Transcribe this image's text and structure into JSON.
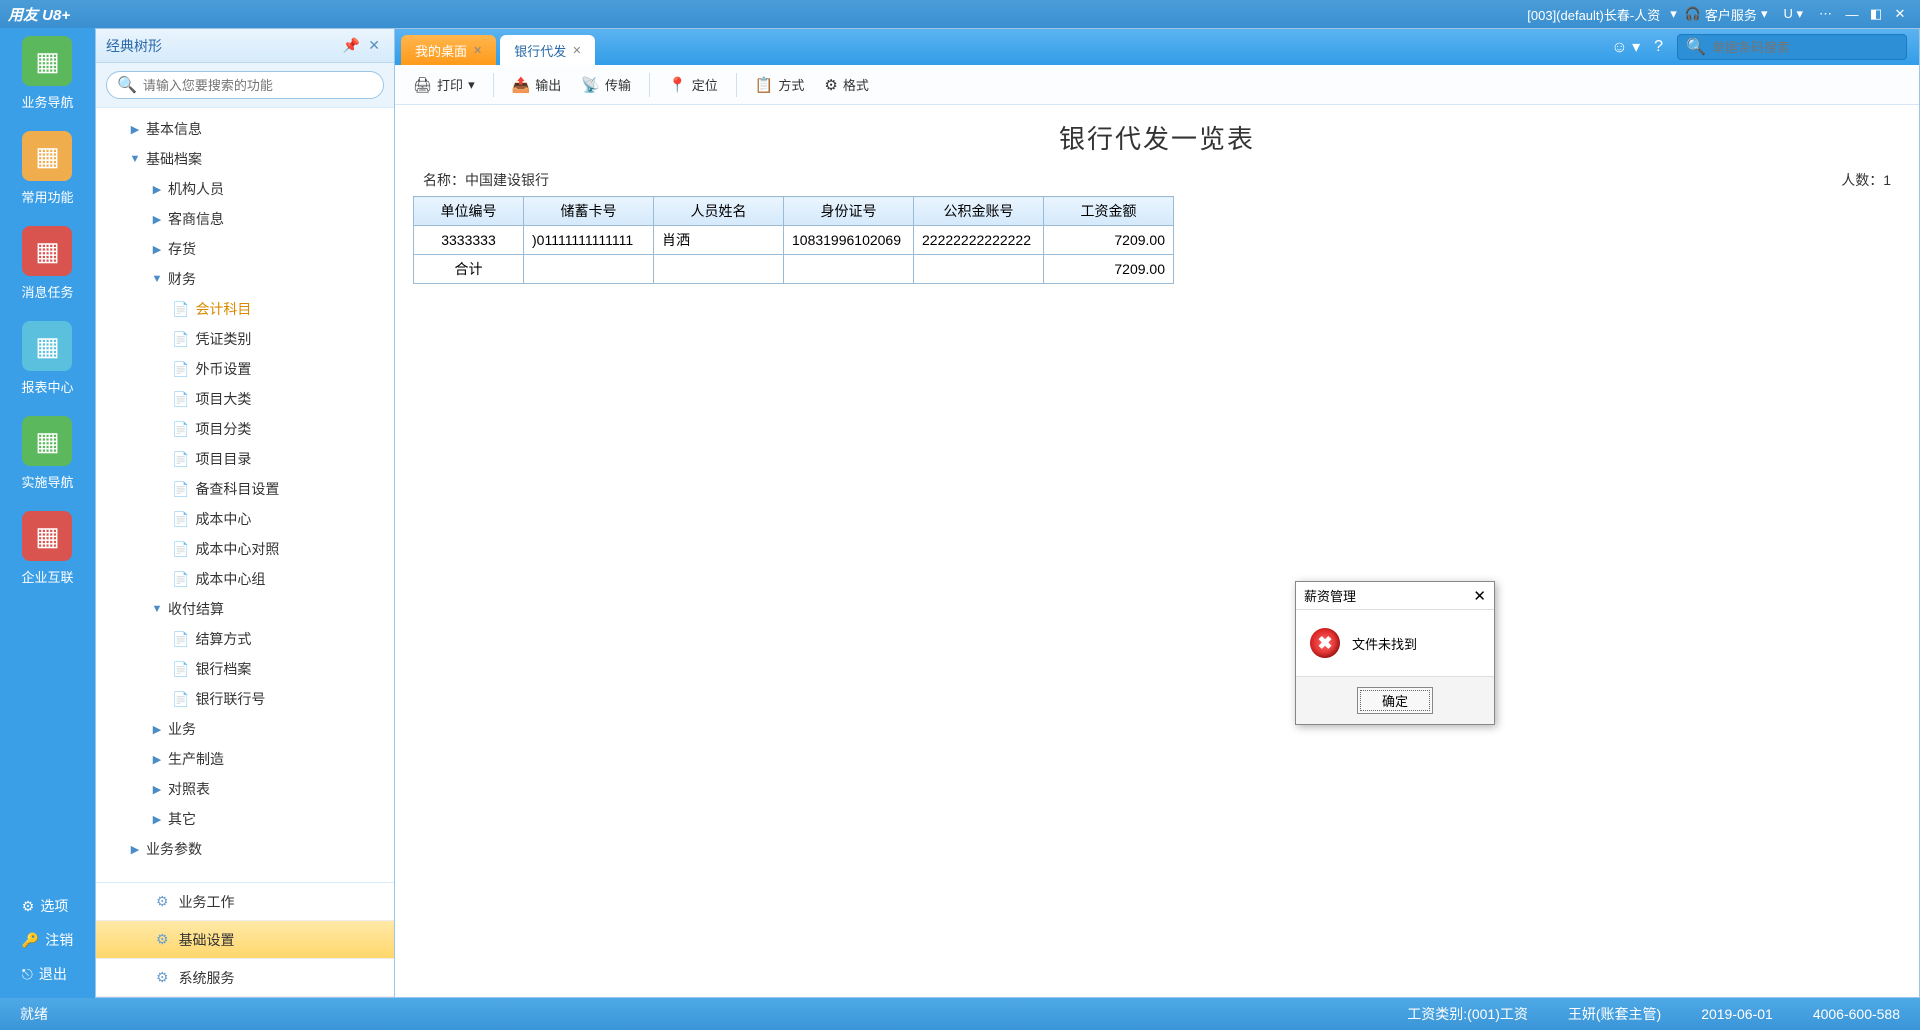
{
  "titlebar": {
    "brand": "用友 U8+",
    "seginfo": "[003](default)长春-人资",
    "service": "客户服务"
  },
  "rail": {
    "items": [
      {
        "label": "业务导航",
        "color": "#5cb85c"
      },
      {
        "label": "常用功能",
        "color": "#f0ad4e"
      },
      {
        "label": "消息任务",
        "color": "#d9534f"
      },
      {
        "label": "报表中心",
        "color": "#5bc0de"
      },
      {
        "label": "实施导航",
        "color": "#5cb85c"
      },
      {
        "label": "企业互联",
        "color": "#d9534f"
      }
    ],
    "bottom": [
      {
        "label": "选项",
        "icon": "⚙"
      },
      {
        "label": "注销",
        "icon": "🔑"
      },
      {
        "label": "退出",
        "icon": "⎋"
      }
    ]
  },
  "tree": {
    "title": "经典树形",
    "searchPlaceholder": "请输入您要搜索的功能",
    "nodes": [
      {
        "label": "基本信息",
        "type": "branch",
        "indent": 1,
        "arrow": "▶"
      },
      {
        "label": "基础档案",
        "type": "branch",
        "indent": 1,
        "arrow": "▼"
      },
      {
        "label": "机构人员",
        "type": "branch",
        "indent": 2,
        "arrow": "▶"
      },
      {
        "label": "客商信息",
        "type": "branch",
        "indent": 2,
        "arrow": "▶"
      },
      {
        "label": "存货",
        "type": "branch",
        "indent": 2,
        "arrow": "▶"
      },
      {
        "label": "财务",
        "type": "branch",
        "indent": 2,
        "arrow": "▼"
      },
      {
        "label": "会计科目",
        "type": "leaf",
        "indent": 3,
        "hl": true
      },
      {
        "label": "凭证类别",
        "type": "leaf",
        "indent": 3
      },
      {
        "label": "外币设置",
        "type": "leaf",
        "indent": 3
      },
      {
        "label": "项目大类",
        "type": "leaf",
        "indent": 3
      },
      {
        "label": "项目分类",
        "type": "leaf",
        "indent": 3
      },
      {
        "label": "项目目录",
        "type": "leaf",
        "indent": 3
      },
      {
        "label": "备查科目设置",
        "type": "leaf",
        "indent": 3
      },
      {
        "label": "成本中心",
        "type": "leaf",
        "indent": 3
      },
      {
        "label": "成本中心对照",
        "type": "leaf",
        "indent": 3
      },
      {
        "label": "成本中心组",
        "type": "leaf",
        "indent": 3
      },
      {
        "label": "收付结算",
        "type": "branch",
        "indent": 2,
        "arrow": "▼"
      },
      {
        "label": "结算方式",
        "type": "leaf",
        "indent": 3
      },
      {
        "label": "银行档案",
        "type": "leaf",
        "indent": 3
      },
      {
        "label": "银行联行号",
        "type": "leaf",
        "indent": 3
      },
      {
        "label": "业务",
        "type": "branch",
        "indent": 2,
        "arrow": "▶"
      },
      {
        "label": "生产制造",
        "type": "branch",
        "indent": 2,
        "arrow": "▶"
      },
      {
        "label": "对照表",
        "type": "branch",
        "indent": 2,
        "arrow": "▶"
      },
      {
        "label": "其它",
        "type": "branch",
        "indent": 2,
        "arrow": "▶"
      },
      {
        "label": "业务参数",
        "type": "branch",
        "indent": 1,
        "arrow": "▶"
      }
    ],
    "bottomTabs": [
      {
        "label": "业务工作",
        "active": false
      },
      {
        "label": "基础设置",
        "active": true
      },
      {
        "label": "系统服务",
        "active": false
      }
    ]
  },
  "tabs": [
    {
      "label": "我的桌面",
      "active": false
    },
    {
      "label": "银行代发",
      "active": true
    }
  ],
  "tabSearchPlaceholder": "单据条码搜索",
  "toolbar": [
    {
      "label": "打印",
      "icon": "🖨",
      "dd": true
    },
    {
      "sep": true
    },
    {
      "label": "输出",
      "icon": "📤"
    },
    {
      "label": "传输",
      "icon": "📡"
    },
    {
      "sep": true
    },
    {
      "label": "定位",
      "icon": "📍"
    },
    {
      "sep": true
    },
    {
      "label": "方式",
      "icon": "📋"
    },
    {
      "label": "格式",
      "icon": "⚙"
    }
  ],
  "report": {
    "title": "银行代发一览表",
    "nameLabel": "名称：",
    "nameValue": "中国建设银行",
    "countLabel": "人数：",
    "countValue": "1",
    "headers": [
      "单位编号",
      "储蓄卡号",
      "人员姓名",
      "身份证号",
      "公积金账号",
      "工资金额"
    ],
    "rows": [
      [
        "3333333",
        ")01111111111111",
        "肖洒",
        "10831996102069",
        "22222222222222",
        "7209.00"
      ]
    ],
    "totalLabel": "合计",
    "totalAmount": "7209.00"
  },
  "modal": {
    "title": "薪资管理",
    "message": "文件未找到",
    "ok": "确定"
  },
  "status": {
    "ready": "就绪",
    "salaryType": "工资类别:(001)工资",
    "user": "王妍(账套主管)",
    "date": "2019-06-01",
    "phone": "4006-600-588"
  }
}
